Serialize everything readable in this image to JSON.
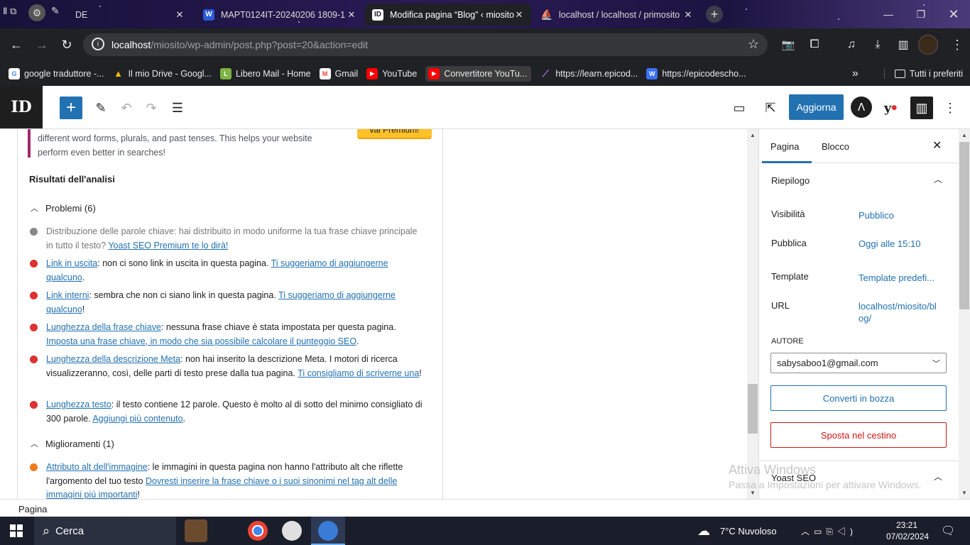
{
  "browser": {
    "tabs": [
      {
        "title": "DE",
        "active": false
      },
      {
        "title": "MAPT0124IT-20240206 1809-1",
        "active": false
      },
      {
        "title": "Modifica pagina “Blog” ‹ miosito",
        "active": true
      },
      {
        "title": "localhost / localhost / primosito",
        "active": false
      }
    ],
    "new_tab": "+",
    "url_host": "localhost",
    "url_path": "/miosito/wp-admin/post.php?post=20&action=edit",
    "bookmarks": [
      {
        "label": "google traduttore -...",
        "color": "#4285f4",
        "icon": "G"
      },
      {
        "label": "Il mio Drive - Googl...",
        "color": "#fbbc04",
        "icon": "▲"
      },
      {
        "label": "Libero Mail - Home",
        "color": "#7cb342",
        "icon": "L"
      },
      {
        "label": "Gmail",
        "color": "#ea4335",
        "icon": "M"
      },
      {
        "label": "YouTube",
        "color": "#ff0000",
        "icon": "▶"
      },
      {
        "label": "Convertitore YouTu...",
        "color": "#ff0000",
        "icon": "▶"
      },
      {
        "label": "https://learn.epicod...",
        "color": "#8a2be2",
        "icon": "⟋"
      },
      {
        "label": "https://epicodescho...",
        "color": "#3a6ff7",
        "icon": "W"
      }
    ],
    "more_bookmarks": "»",
    "all_bookmarks": "Tutti i preferiti"
  },
  "wp": {
    "update_button": "Aggiorna",
    "plus": "+",
    "premium_button": "vai Premium!",
    "intro_text": "different word forms, plurals, and past tenses. This helps your website perform even better in searches!",
    "analysis_title": "Risultati dell'analisi",
    "problems_header": "Problemi (6)",
    "improvements_header": "Miglioramenti (1)",
    "problems": [
      {
        "color": "#888888",
        "link": "",
        "text": "Distribuzione delle parole chiave: hai distribuito in modo uniforme la tua frase chiave principale in tutto il testo? ",
        "cta": "Yoast SEO Premium te lo dirà!",
        "tail": ""
      },
      {
        "color": "#dc3232",
        "link": "Link in uscita",
        "text": ": non ci sono link in uscita in questa pagina. ",
        "cta": "Ti suggeriamo di aggiungerne qualcuno",
        "tail": "."
      },
      {
        "color": "#dc3232",
        "link": "Link interni",
        "text": ": sembra che non ci siano link in questa pagina. ",
        "cta": "Ti suggeriamo di aggiungerne qualcuno",
        "tail": "!"
      },
      {
        "color": "#dc3232",
        "link": "Lunghezza della frase chiave",
        "text": ": nessuna frase chiave è stata impostata per questa pagina. ",
        "cta": "Imposta una frase chiave, in modo che sia possibile calcolare il punteggio SEO",
        "tail": "."
      },
      {
        "color": "#dc3232",
        "link": "Lunghezza della descrizione Meta",
        "text": ": non hai inserito la descrizione Meta. I motori di ricerca visualizzeranno, così, delle parti di testo prese dalla tua pagina. ",
        "cta": "Ti consigliamo di scriverne una",
        "tail": "!"
      },
      {
        "color": "#dc3232",
        "link": "Lunghezza testo",
        "text": ": il testo contiene 12 parole. Questo è molto al di sotto del minimo consigliato di 300 parole. ",
        "cta": "Aggiungi più contenuto",
        "tail": "."
      }
    ],
    "improvements": [
      {
        "color": "#ee7c1b",
        "link": "Attributo alt dell'immagine",
        "text": ": le immagini in questa pagina non hanno l'attributo alt che riflette l'argomento del tuo testo ",
        "cta": "Dovresti inserire la frase chiave o i suoi sinonimi nel tag alt delle immagini più importanti",
        "tail": "!"
      }
    ],
    "sidebar": {
      "tab_page": "Pagina",
      "tab_block": "Blocco",
      "summary": "Riepilogo",
      "visibility_label": "Visibilità",
      "visibility_value": "Pubblico",
      "publish_label": "Pubblica",
      "publish_value": "Oggi alle 15:10",
      "template_label": "Template",
      "template_value": "Template predefi...",
      "url_label": "URL",
      "url_value": "localhost/miosito/blog/",
      "author_label": "AUTORE",
      "author_value": "sabysaboo1@gmail.com",
      "draft_button": "Converti in bozza",
      "trash_button": "Sposta nel cestino",
      "yoast": "Yoast SEO"
    },
    "status_bar": "Pagina"
  },
  "watermark": {
    "title": "Attiva Windows",
    "subtitle": "Passa a Impostazioni per attivare Windows."
  },
  "taskbar": {
    "search": "Cerca",
    "weather": "7°C  Nuvoloso",
    "time": "23:21",
    "date": "07/02/2024"
  }
}
